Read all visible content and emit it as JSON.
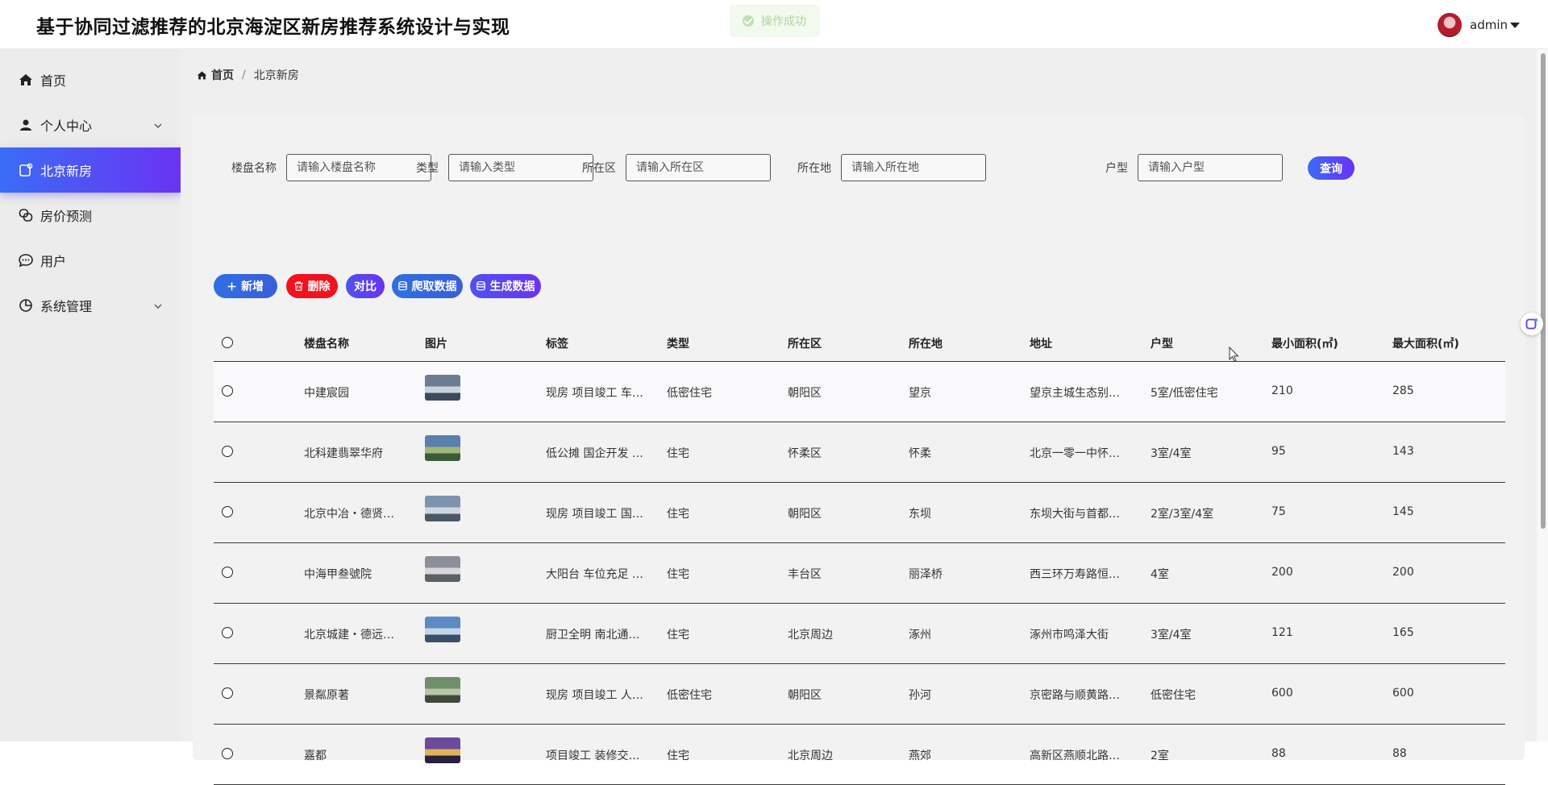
{
  "header": {
    "title": "基于协同过滤推荐的北京海淀区新房推荐系统设计与实现",
    "toast": "操作成功",
    "username": "admin"
  },
  "sidebar": {
    "items": [
      {
        "label": "首页",
        "icon": "home-icon"
      },
      {
        "label": "个人中心",
        "icon": "user-icon",
        "has_children": true
      },
      {
        "label": "北京新房",
        "icon": "house-doc-icon",
        "active": true
      },
      {
        "label": "房价预测",
        "icon": "link-circles-icon"
      },
      {
        "label": "用户",
        "icon": "chat-bubble-icon"
      },
      {
        "label": "系统管理",
        "icon": "pie-chart-icon",
        "has_children": true
      }
    ]
  },
  "breadcrumb": {
    "home": "首页",
    "separator": "/",
    "current": "北京新房"
  },
  "search": {
    "fields": [
      {
        "label": "楼盘名称",
        "placeholder": "请输入楼盘名称"
      },
      {
        "label": "类型",
        "placeholder": "请输入类型"
      },
      {
        "label": "所在区",
        "placeholder": "请输入所在区"
      },
      {
        "label": "所在地",
        "placeholder": "请输入所在地"
      },
      {
        "label": "户型",
        "placeholder": "请输入户型"
      }
    ],
    "query_label": "查询"
  },
  "toolbar": {
    "add": "新增",
    "delete": "删除",
    "compare": "对比",
    "crawl": "爬取数据",
    "generate": "生成数据"
  },
  "table": {
    "columns": [
      "楼盘名称",
      "图片",
      "标签",
      "类型",
      "所在区",
      "所在地",
      "地址",
      "户型",
      "最小面积(㎡)",
      "最大面积(㎡)"
    ],
    "rows": [
      {
        "name": "中建宸园",
        "tags": "现房 项目竣工 车…",
        "type": "低密住宅",
        "district": "朝阳区",
        "location": "望京",
        "address": "望京主城生态别…",
        "layout": "5室/低密住宅",
        "min_area": "210",
        "max_area": "285"
      },
      {
        "name": "北科建翡翠华府",
        "tags": "低公摊 国企开发 …",
        "type": "住宅",
        "district": "怀柔区",
        "location": "怀柔",
        "address": "北京一零一中怀…",
        "layout": "3室/4室",
        "min_area": "95",
        "max_area": "143"
      },
      {
        "name": "北京中冶・德贤…",
        "tags": "现房 项目竣工 国…",
        "type": "住宅",
        "district": "朝阳区",
        "location": "东坝",
        "address": "东坝大街与首都…",
        "layout": "2室/3室/4室",
        "min_area": "75",
        "max_area": "145"
      },
      {
        "name": "中海甲叁號院",
        "tags": "大阳台 车位充足 …",
        "type": "住宅",
        "district": "丰台区",
        "location": "丽泽桥",
        "address": "西三环万寿路恒…",
        "layout": "4室",
        "min_area": "200",
        "max_area": "200"
      },
      {
        "name": "北京城建・德远…",
        "tags": "厨卫全明 南北通…",
        "type": "住宅",
        "district": "北京周边",
        "location": "涿州",
        "address": "涿州市鸣泽大街",
        "layout": "3室/4室",
        "min_area": "121",
        "max_area": "165"
      },
      {
        "name": "景粼原著",
        "tags": "现房 项目竣工 人…",
        "type": "低密住宅",
        "district": "朝阳区",
        "location": "孙河",
        "address": "京密路与顺黄路…",
        "layout": "低密住宅",
        "min_area": "600",
        "max_area": "600"
      },
      {
        "name": "嘉都",
        "tags": "项目竣工 装修交…",
        "type": "住宅",
        "district": "北京周边",
        "location": "燕郊",
        "address": "高新区燕顺北路…",
        "layout": "2室",
        "min_area": "88",
        "max_area": "88"
      }
    ]
  },
  "colors": {
    "accent_start": "#3b6cf6",
    "accent_end": "#6a33f4",
    "danger": "#f0121c",
    "sidebar_bg": "#ececec"
  }
}
